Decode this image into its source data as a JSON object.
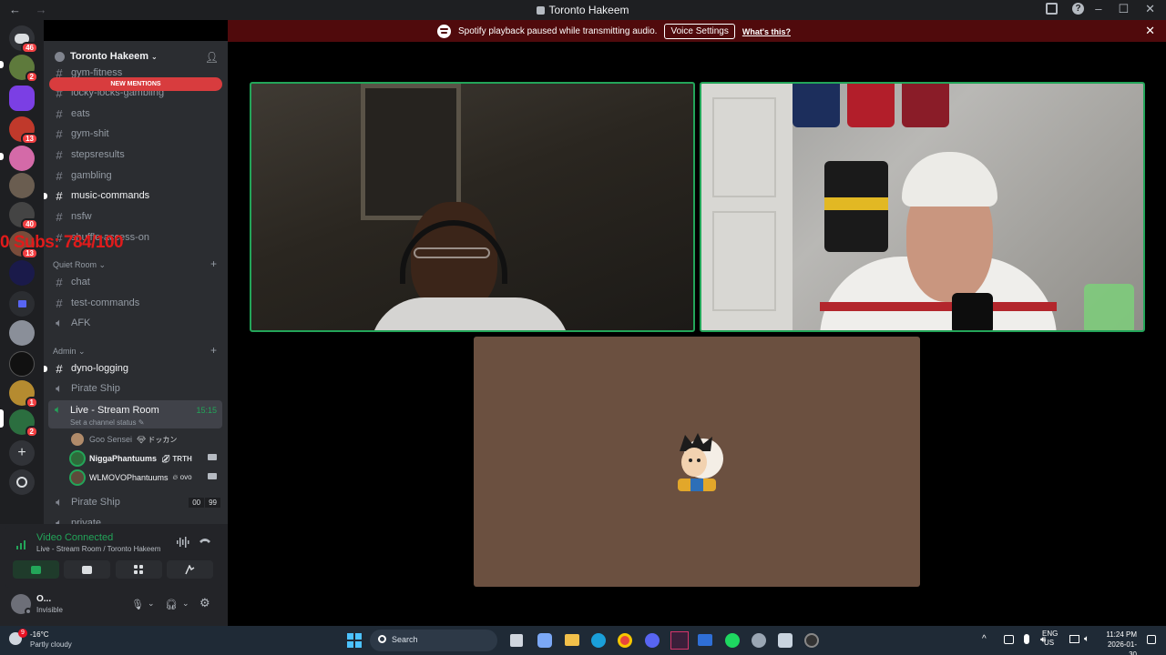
{
  "window": {
    "title": "Toronto Hakeem"
  },
  "notice": {
    "text": "Spotify playback paused while transmitting audio.",
    "button": "Voice Settings",
    "link": "What's this?"
  },
  "rail": {
    "badges": [
      "46",
      "2",
      "13",
      "40",
      "13",
      "1",
      "2"
    ]
  },
  "guild": {
    "name": "Toronto Hakeem",
    "new_mentions": "NEW MENTIONS"
  },
  "channels": {
    "gym_fitness": "gym-fitness",
    "lucky_locks": "locky-locks-gambling",
    "eats": "eats",
    "gym_shit": "gym-shit",
    "stepsresults": "stepsresults",
    "gambling": "gambling",
    "music_commands": "music-commands",
    "nsfw": "nsfw",
    "shuffle": "shuffle-access-on"
  },
  "overlay": "0 Subs: 784/100",
  "quiet_room": {
    "label": "Quiet Room",
    "chat": "chat",
    "test_commands": "test-commands",
    "afk": "AFK"
  },
  "admin": {
    "label": "Admin",
    "dyno": "dyno-logging",
    "pirate_ship": "Pirate Ship",
    "live_room": "Live - Stream Room",
    "live_timer": "15:15",
    "live_status": "Set a channel status",
    "users": [
      {
        "name": "Goo Sensei",
        "tag": "ドッカン"
      },
      {
        "name": "NiggaPhantuums",
        "tag": "TRTH"
      },
      {
        "name": "WLMOVOPhantuums",
        "tag": "ovo"
      }
    ],
    "pirate_ship_2": "Pirate Ship",
    "pirate_counts": [
      "00",
      "99"
    ],
    "private": "private"
  },
  "voice": {
    "status": "Video Connected",
    "location": "Live - Stream Room / Toronto Hakeem"
  },
  "user": {
    "name": "O...",
    "state": "Invisible"
  },
  "colors": {
    "speaking": "#23a559",
    "notice_bg": "#500a0c",
    "new_mentions": "#d83c3e",
    "overlay_text": "#e01b1b"
  }
}
